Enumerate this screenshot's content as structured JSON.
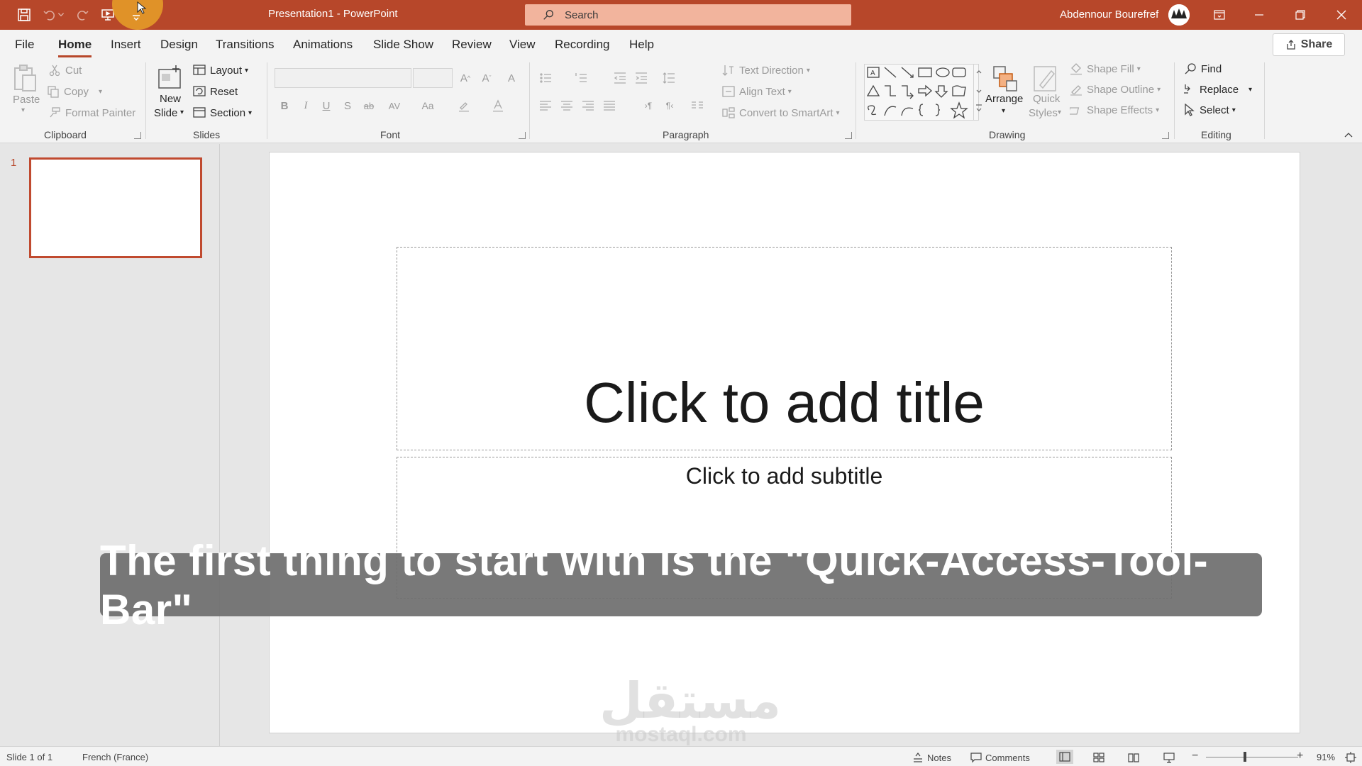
{
  "titlebar": {
    "doc_title": "Presentation1  -  PowerPoint",
    "search_placeholder": "Search",
    "user_name": "Abdennour Bourefref",
    "accent": "#b7472a"
  },
  "quick_access": [
    "save-icon",
    "undo-icon",
    "redo-icon",
    "present-from-start-icon",
    "customize-qat-icon"
  ],
  "menu": {
    "tabs": [
      "File",
      "Home",
      "Insert",
      "Design",
      "Transitions",
      "Animations",
      "Slide Show",
      "Review",
      "View",
      "Recording",
      "Help"
    ],
    "active": "Home",
    "share_label": "Share"
  },
  "ribbon": {
    "clipboard": {
      "paste": "Paste",
      "cut": "Cut",
      "copy": "Copy",
      "format_painter": "Format Painter",
      "label": "Clipboard"
    },
    "slides": {
      "new_slide_1": "New",
      "new_slide_2": "Slide",
      "layout": "Layout",
      "reset": "Reset",
      "section": "Section",
      "label": "Slides"
    },
    "font": {
      "label": "Font",
      "bold": "B",
      "italic": "I",
      "underline": "U",
      "shadow": "S",
      "strike": "ab",
      "spacing": "AV",
      "case": "Aa"
    },
    "paragraph": {
      "text_direction": "Text Direction",
      "align_text": "Align Text",
      "convert_smartart": "Convert to SmartArt",
      "label": "Paragraph"
    },
    "drawing": {
      "arrange": "Arrange",
      "quick_styles_1": "Quick",
      "quick_styles_2": "Styles",
      "shape_fill": "Shape Fill",
      "shape_outline": "Shape Outline",
      "shape_effects": "Shape Effects",
      "label": "Drawing"
    },
    "editing": {
      "find": "Find",
      "replace": "Replace",
      "select": "Select",
      "label": "Editing"
    }
  },
  "thumbnails": {
    "slide_number": "1"
  },
  "slide": {
    "title_placeholder": "Click to add title",
    "subtitle_placeholder": "Click to add subtitle"
  },
  "caption": "The first thing to start with is the \"Quick-Access-Tool-Bar\"",
  "watermark": {
    "arabic": "مستقل",
    "latin": "mostaql.com"
  },
  "statusbar": {
    "slide_info": "Slide 1 of 1",
    "language": "French (France)",
    "notes": "Notes",
    "comments": "Comments",
    "zoom": "91%",
    "zoom_percent": 91
  }
}
